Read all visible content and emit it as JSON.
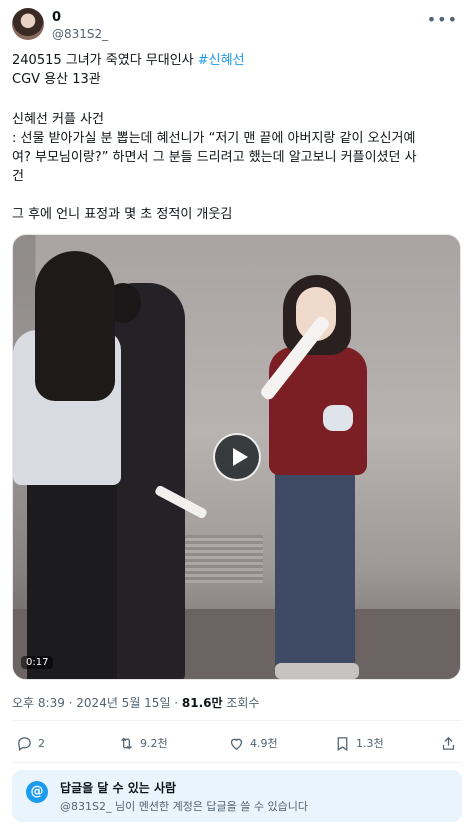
{
  "author": {
    "display_name": "0",
    "handle": "@831S2_"
  },
  "post": {
    "line1_text": "240515 그녀가 죽였다 무대인사 ",
    "line1_hashtag": "#신혜선",
    "line2": "CGV 용산 13관",
    "section_title": "신혜선 커플 사건",
    "paragraph_line1": ": 선물 받아가실 분 뽑는데 혜선니가 “저기 맨 끝에 아버지랑 같이 오신거예",
    "paragraph_line2": "여? 부모님이랑?” 하면서 그 분들 드리려고 했는데 알고보니 커플이셨던 사",
    "paragraph_line3": "건",
    "closing": "그 후에 언니 표정과 몇 초 정적이 개웃김"
  },
  "video": {
    "duration": "0:17"
  },
  "meta": {
    "timestamp": "오후 8:39 · 2024년 5월 15일 · ",
    "views_count": "81.6만",
    "views_label": " 조회수"
  },
  "actions": {
    "replies": "2",
    "reposts": "9.2천",
    "likes": "4.9천",
    "bookmarks": "1.3천"
  },
  "reply_restriction": {
    "icon_symbol": "@",
    "title": "답글을 달 수 있는 사람",
    "description": "@831S2_ 님이 멘션한 계정은 답글을 쓸 수 있습니다"
  },
  "icons": [
    "more-icon",
    "reply-icon",
    "repost-icon",
    "like-icon",
    "bookmark-icon",
    "share-icon",
    "play-icon",
    "mention-icon"
  ],
  "colors": {
    "accent": "#1d9bf0",
    "text_primary": "#0f1419",
    "text_secondary": "#536471",
    "reply_box_bg": "#eaf4fd"
  }
}
